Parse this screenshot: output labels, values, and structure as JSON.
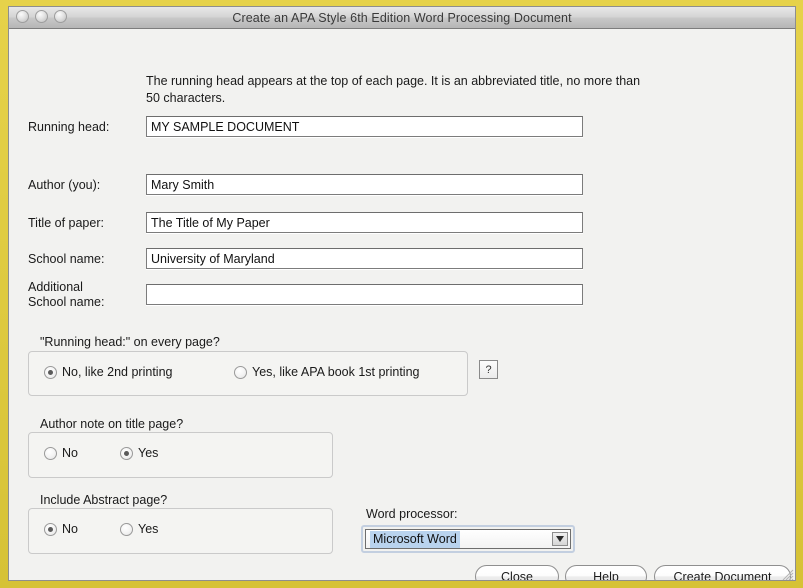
{
  "window": {
    "title": "Create an APA Style 6th Edition Word Processing Document",
    "traffic_lights": [
      "close",
      "minimize",
      "zoom"
    ],
    "frame_color": "#d9c63a",
    "body_color": "#f2f2f0"
  },
  "intro": {
    "text": "The running head appears at the top of each page. It is an abbreviated title, no more than 50 characters."
  },
  "fields": [
    {
      "label": "Running head:",
      "value": "MY SAMPLE DOCUMENT",
      "placeholder": ""
    },
    {
      "label": "Author (you):",
      "value": "Mary Smith",
      "placeholder": ""
    },
    {
      "label": "Title of paper:",
      "value": "The Title of My Paper",
      "placeholder": ""
    },
    {
      "label": "School name:",
      "value": "University of Maryland",
      "placeholder": ""
    },
    {
      "label_line1": "Additional",
      "label_line2": "School name:",
      "value": "",
      "placeholder": ""
    }
  ],
  "groups": [
    {
      "title": "\"Running head:\" on every page?",
      "options": [
        {
          "label": "No, like 2nd printing",
          "selected": true
        },
        {
          "label": "Yes, like APA book 1st printing",
          "selected": false
        }
      ],
      "help_label": "?"
    },
    {
      "title": "Author note on title page?",
      "options": [
        {
          "label": "No",
          "selected": false
        },
        {
          "label": "Yes",
          "selected": true
        }
      ]
    },
    {
      "title": "Include Abstract page?",
      "options": [
        {
          "label": "No",
          "selected": true
        },
        {
          "label": "Yes",
          "selected": false
        }
      ]
    }
  ],
  "word_processor": {
    "label": "Word processor:",
    "selected": "Microsoft Word",
    "highlight_color": "#b9d3ee"
  },
  "buttons": {
    "close": "Close",
    "help": "Help",
    "create": "Create Document"
  }
}
